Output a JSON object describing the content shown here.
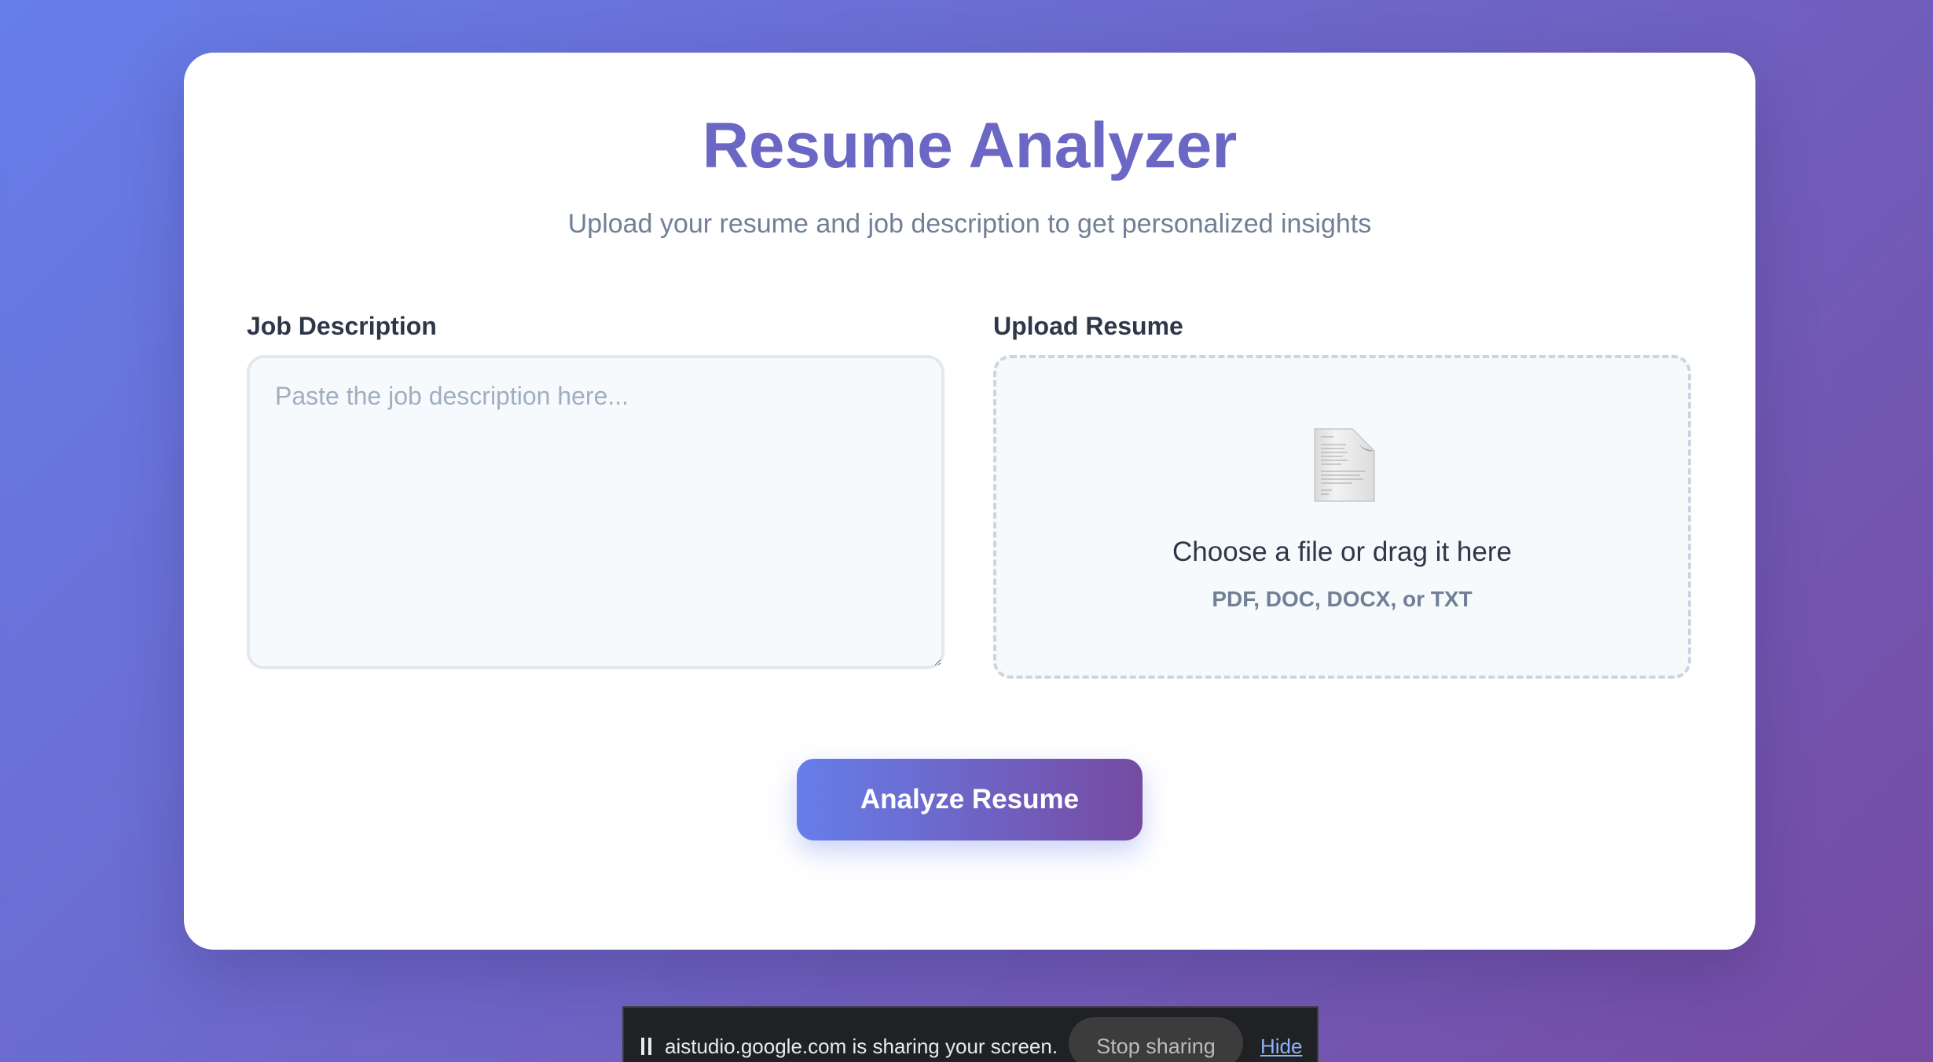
{
  "app": {
    "title": "Resume Analyzer",
    "subtitle": "Upload your resume and job description to get personalized insights"
  },
  "job_description": {
    "label": "Job Description",
    "placeholder": "Paste the job description here...",
    "value": ""
  },
  "upload": {
    "label": "Upload Resume",
    "icon": "document-icon",
    "prompt": "Choose a file or drag it here",
    "accepted_formats": "PDF, DOC, DOCX, or TXT"
  },
  "actions": {
    "analyze_label": "Analyze Resume"
  },
  "screen_share": {
    "message": "aistudio.google.com is sharing your screen.",
    "stop_label": "Stop sharing",
    "hide_label": "Hide"
  },
  "colors": {
    "accent": "#667eea",
    "accent_end": "#764ba2",
    "title": "#6b67c4"
  }
}
